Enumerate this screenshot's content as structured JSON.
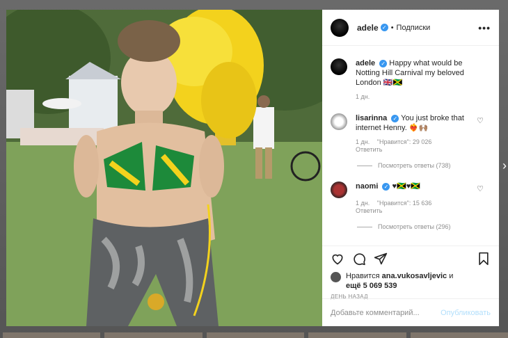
{
  "post": {
    "author": "adele",
    "dot": "•",
    "follow_label": "Подписки",
    "more_label": "•••"
  },
  "caption": {
    "author": "adele",
    "text": "Happy what would be Notting Hill Carnival my beloved London 🇬🇧🇯🇲",
    "time": "1 дн."
  },
  "comments": [
    {
      "author": "lisarinna",
      "text": "You just broke that internet Henny. ❤️‍🔥🙌🏽",
      "time": "1 дн.",
      "likes": "\"Нравится\": 29 026",
      "reply": "Ответить",
      "view_replies": "Посмотреть ответы (738)"
    },
    {
      "author": "naomi",
      "text": "♥🇯🇲♥🇯🇲",
      "time": "1 дн.",
      "likes": "\"Нравится\": 15 636",
      "reply": "Ответить",
      "view_replies": "Посмотреть ответы (296)"
    }
  ],
  "likes": {
    "prefix": "Нравится",
    "user": "ana.vukosavljevic",
    "and": "и",
    "others": "ещё 5 069 539"
  },
  "posted_ago": "ДЕНЬ НАЗАД",
  "add_comment": {
    "placeholder": "Добавьте комментарий...",
    "publish": "Опубликовать"
  },
  "icons": [
    "heart-icon",
    "comment-icon",
    "share-icon",
    "bookmark-icon",
    "verified-badge",
    "chevron-right-icon"
  ],
  "colors": {
    "verified": "#3897f0",
    "publish_disabled": "#b2dffc",
    "meta_gray": "#8e8e8e"
  }
}
